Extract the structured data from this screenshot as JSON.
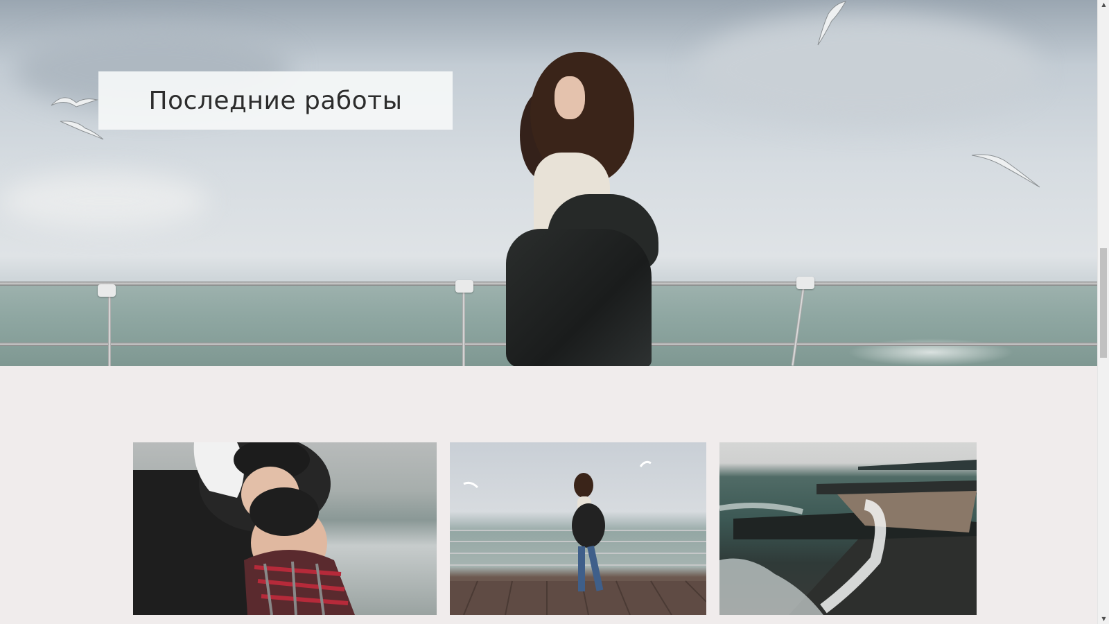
{
  "hero": {
    "title": "Последние работы"
  },
  "gallery": {
    "items": [
      {
        "alt": "Couple hugging on seashore"
      },
      {
        "alt": "Woman in puffer jacket on pier"
      },
      {
        "alt": "Waves crashing over breakwater"
      }
    ]
  },
  "scrollbar": {
    "up_icon": "▲",
    "down_icon": "▼"
  },
  "colors": {
    "page_background": "#f0ecec",
    "title_background": "#f5f7f8",
    "title_text": "#2c2c2c"
  }
}
